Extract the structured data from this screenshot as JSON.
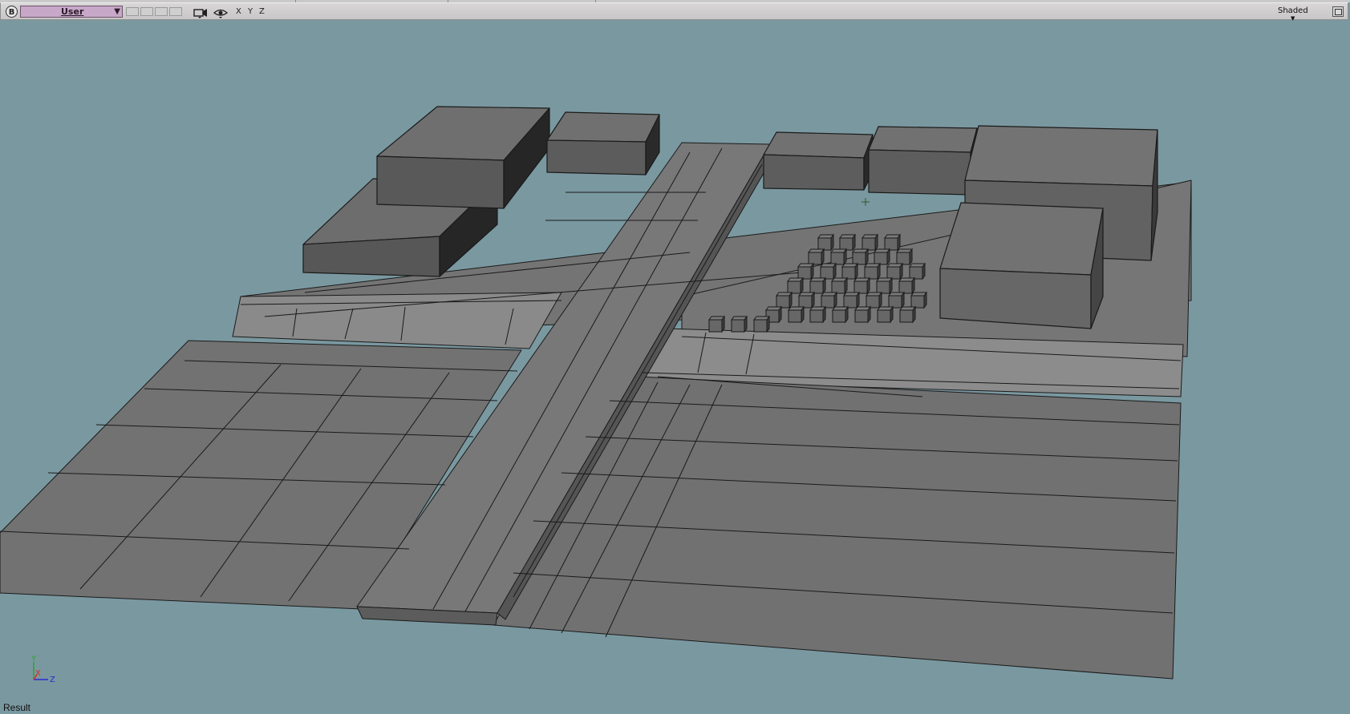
{
  "toolbar": {
    "badge": "B",
    "camera_view": "User",
    "axis_x": "X",
    "axis_y": "Y",
    "axis_z": "Z",
    "shading_mode": "Shaded",
    "icons": [
      "camera-icon",
      "eye-icon",
      "maximize-icon"
    ]
  },
  "viewport": {
    "background_color": "#7a98a0",
    "mesh_color": "#737373",
    "edge_color": "#1a1a1a",
    "gizmo": {
      "y": "Y",
      "x": "X",
      "z": "Z"
    }
  },
  "status": {
    "text": "Result"
  }
}
